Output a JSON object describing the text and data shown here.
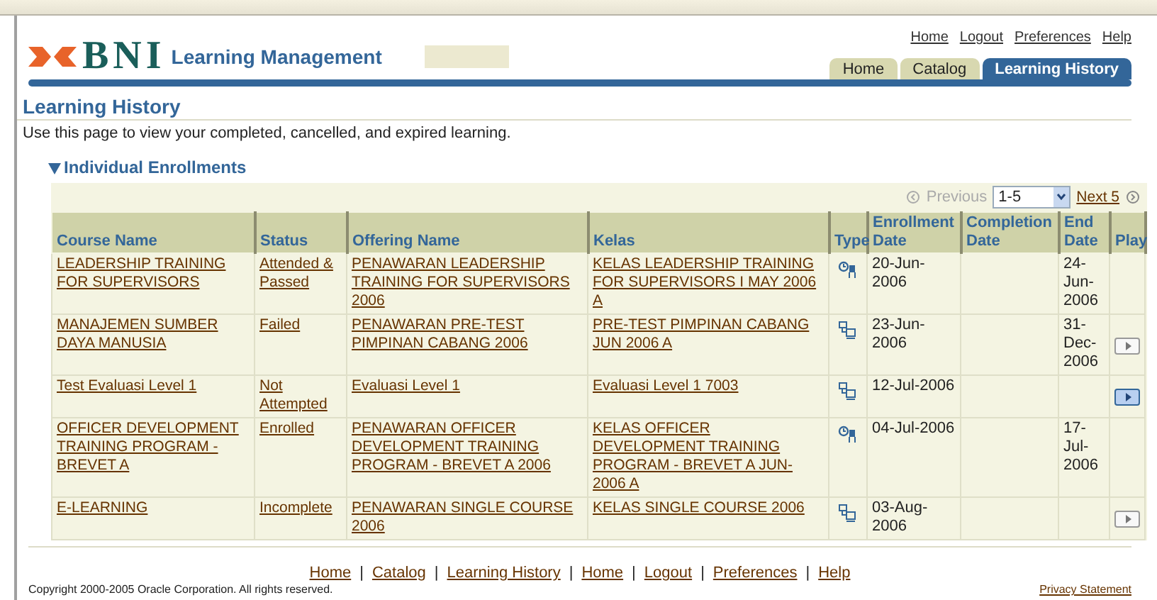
{
  "header": {
    "brand": "BNI",
    "product": "Learning Management",
    "global_links": [
      "Home",
      "Logout",
      "Preferences",
      "Help"
    ],
    "tabs": [
      {
        "label": "Home",
        "selected": false
      },
      {
        "label": "Catalog",
        "selected": false
      },
      {
        "label": "Learning History",
        "selected": true
      }
    ]
  },
  "page": {
    "title": "Learning History",
    "description": "Use this page to view your completed, cancelled, and expired learning."
  },
  "section": {
    "title": "Individual Enrollments",
    "expanded": true,
    "pagination": {
      "previous": "Previous",
      "range": "1-5",
      "next": "Next 5",
      "previous_disabled": true
    },
    "columns": [
      "Course Name",
      "Status",
      "Offering Name",
      "Kelas",
      "Type",
      "Enrollment Date",
      "Completion Date",
      "End Date",
      "Play"
    ],
    "rows": [
      {
        "course": "LEADERSHIP TRAINING FOR SUPERVISORS",
        "status": "Attended & Passed",
        "offering": "PENAWARAN LEADERSHIP TRAINING FOR SUPERVISORS 2006",
        "kelas": "KELAS LEADERSHIP TRAINING FOR SUPERVISORS I MAY 2006 A",
        "type_icon": {
          "kind": "classroom"
        },
        "enrollment_date": "20-Jun-2006",
        "end_date": "24-Jun-2006"
      },
      {
        "course": "MANAJEMEN SUMBER DAYA MANUSIA",
        "status": "Failed",
        "offering": "PENAWARAN PRE-TEST PIMPINAN CABANG 2006",
        "kelas": "PRE-TEST PIMPINAN CABANG JUN 2006 A",
        "type_icon": {
          "kind": "online"
        },
        "enrollment_date": "23-Jun-2006",
        "end_date": "31-Dec-2006",
        "play": {
          "kind": "inactive"
        }
      },
      {
        "course": "Test Evaluasi Level 1",
        "status": "Not Attempted",
        "offering": "Evaluasi Level 1",
        "kelas": "Evaluasi Level 1 7003",
        "type_icon": {
          "kind": "online"
        },
        "enrollment_date": "12-Jul-2006",
        "play": {
          "kind": "active"
        }
      },
      {
        "course": "OFFICER DEVELOPMENT TRAINING PROGRAM - BREVET A",
        "status": "Enrolled",
        "offering": "PENAWARAN OFFICER DEVELOPMENT TRAINING PROGRAM - BREVET A 2006",
        "kelas": "KELAS OFFICER DEVELOPMENT TRAINING PROGRAM - BREVET A JUN-2006 A",
        "type_icon": {
          "kind": "classroom"
        },
        "enrollment_date": "04-Jul-2006",
        "end_date": "17-Jul-2006"
      },
      {
        "course": "E-LEARNING",
        "status": "Incomplete",
        "offering": "PENAWARAN SINGLE COURSE 2006",
        "kelas": "KELAS SINGLE COURSE 2006",
        "type_icon": {
          "kind": "online"
        },
        "enrollment_date": "03-Aug-2006",
        "play": {
          "kind": "inactive"
        }
      }
    ]
  },
  "footer": {
    "links": [
      "Home",
      "Catalog",
      "Learning History",
      "Home",
      "Logout",
      "Preferences",
      "Help"
    ],
    "separators": [
      "|",
      "|",
      "|",
      "|",
      "|",
      "|"
    ],
    "copyright": "Copyright 2000-2005 Oracle Corporation. All rights reserved.",
    "privacy": "Privacy Statement"
  }
}
